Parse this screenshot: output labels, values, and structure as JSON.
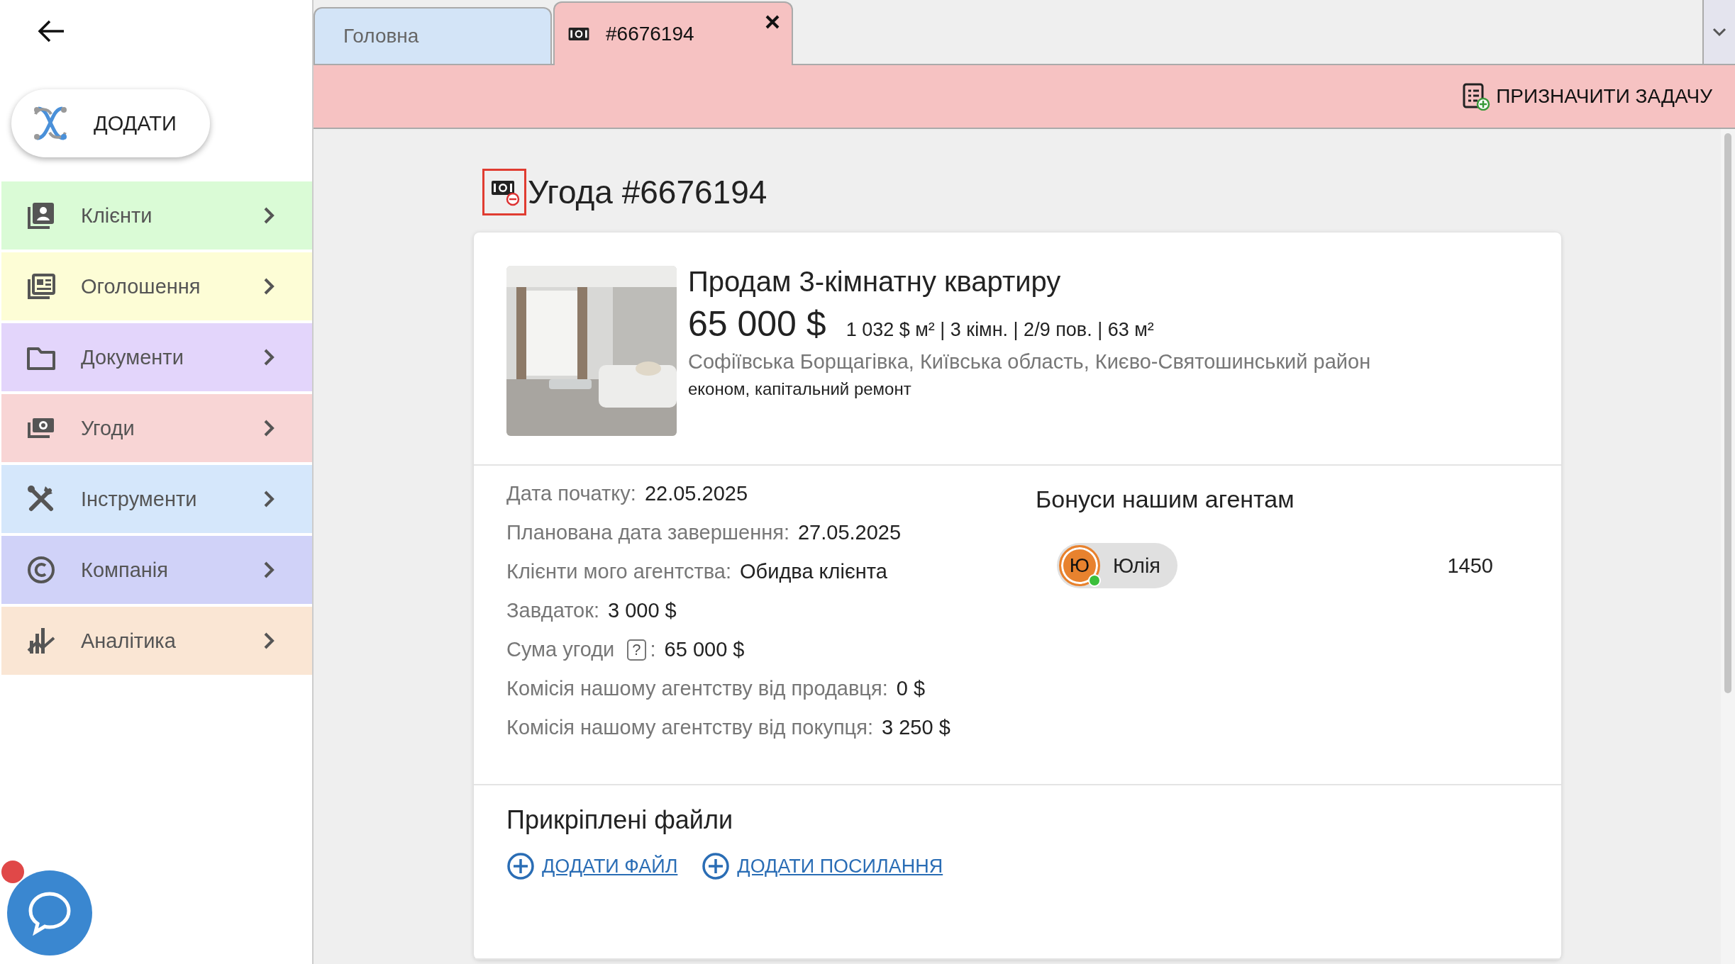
{
  "sidebar": {
    "add_button": "ДОДАТИ",
    "items": [
      {
        "label": "Клієнти",
        "color": "#dafbd6"
      },
      {
        "label": "Оголошення",
        "color": "#fdfdd6"
      },
      {
        "label": "Документи",
        "color": "#e3d5fb"
      },
      {
        "label": "Угоди",
        "color": "#f8d5d5"
      },
      {
        "label": "Інструменти",
        "color": "#d5e7fb"
      },
      {
        "label": "Компанія",
        "color": "#d0d2f8"
      },
      {
        "label": "Аналітика",
        "color": "#fae6d4"
      }
    ]
  },
  "tabs": [
    {
      "label": "Головна",
      "kind": "page",
      "selected": false,
      "closable": false
    },
    {
      "label": "#6676194",
      "kind": "deal",
      "selected": true,
      "closable": true
    }
  ],
  "action_bar": {
    "button": "ПРИЗНАЧИТИ ЗАДАЧУ"
  },
  "deal": {
    "title": "Угода #6676194",
    "icon_highlighted": true,
    "listing": {
      "title": "Продам 3-кімнатну квартиру",
      "price": "65 000 $",
      "specs": "1 032 $ м² | 3 кімн. | 2/9 пов. | 63 м²",
      "address": "Софіївська Борщагівка, Київська область, Києво-Святошинський район",
      "tags": "економ, капітальний ремонт"
    },
    "details": [
      {
        "label": "Дата початку:",
        "value": "22.05.2025"
      },
      {
        "label": "Планована дата завершення:",
        "value": "27.05.2025"
      },
      {
        "label": "Клієнти мого агентства:",
        "value": "Обидва клієнта"
      },
      {
        "label": "Завдаток:",
        "value": "3 000 $"
      },
      {
        "label": "Сума угоди",
        "help": "?",
        "label_end": ":",
        "value": "65 000 $"
      },
      {
        "label": "Комісія нашому агентству від продавця:",
        "value": "0 $"
      },
      {
        "label": "Комісія нашому агентству від покупця:",
        "value": "3 250 $"
      }
    ],
    "bonuses": {
      "title": "Бонуси нашим агентам",
      "agents": [
        {
          "initial": "Ю",
          "name": "Юлія",
          "online": true,
          "amount": "1450"
        }
      ]
    },
    "files": {
      "title": "Прикріплені файли",
      "links": [
        "ДОДАТИ ФАЙЛ",
        "ДОДАТИ ПОСИЛАННЯ"
      ]
    }
  },
  "chat": {
    "unread": true
  }
}
